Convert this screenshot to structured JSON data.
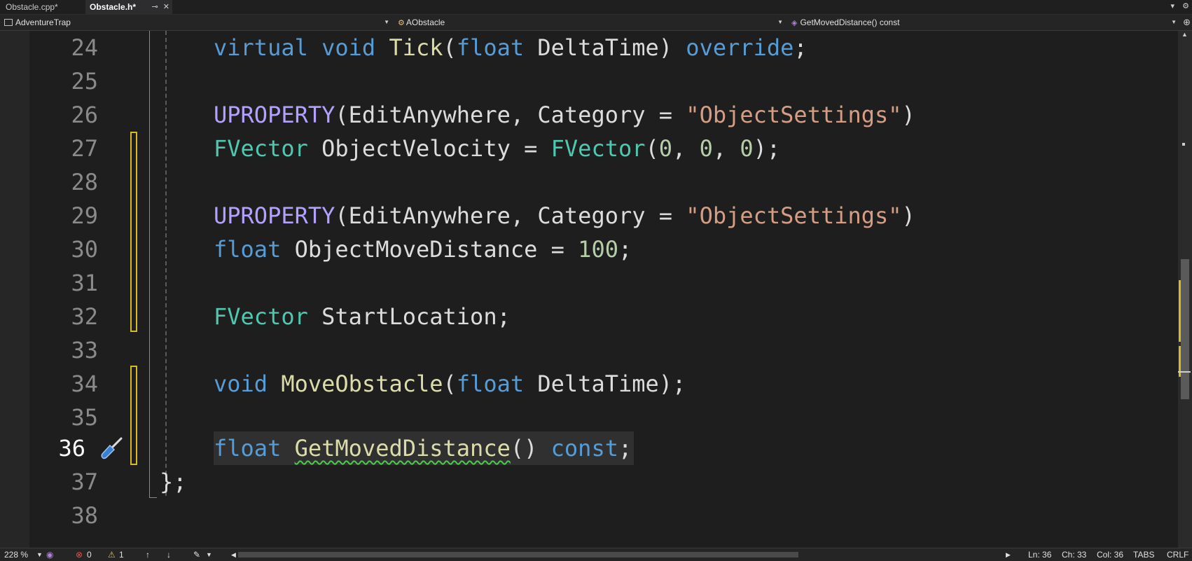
{
  "tabs": [
    {
      "label": "Obstacle.cpp*",
      "active": false
    },
    {
      "label": "Obstacle.h*",
      "active": true
    }
  ],
  "tab_icons": {
    "pin": "⊸",
    "close": "✕"
  },
  "tabbar_right": {
    "dropdown": "▾",
    "settings": "⚙"
  },
  "navbar": {
    "project": "AdventureTrap",
    "class": "AObstacle",
    "member": "GetMovedDistance() const"
  },
  "editor": {
    "current_line": 36,
    "lines": [
      {
        "num": "24",
        "text": "virtual void Tick(float DeltaTime) override;"
      },
      {
        "num": "25",
        "text": ""
      },
      {
        "num": "26",
        "text": "UPROPERTY(EditAnywhere, Category = \"ObjectSettings\")"
      },
      {
        "num": "27",
        "text": "FVector ObjectVelocity = FVector(0, 0, 0);"
      },
      {
        "num": "28",
        "text": ""
      },
      {
        "num": "29",
        "text": "UPROPERTY(EditAnywhere, Category = \"ObjectSettings\")"
      },
      {
        "num": "30",
        "text": "float ObjectMoveDistance = 100;"
      },
      {
        "num": "31",
        "text": ""
      },
      {
        "num": "32",
        "text": "FVector StartLocation;"
      },
      {
        "num": "33",
        "text": ""
      },
      {
        "num": "34",
        "text": "void MoveObstacle(float DeltaTime);"
      },
      {
        "num": "35",
        "text": ""
      },
      {
        "num": "36",
        "text": "float GetMovedDistance() const;"
      },
      {
        "num": "37",
        "text": "};"
      },
      {
        "num": "38",
        "text": ""
      }
    ]
  },
  "colors": {
    "keyword": "#569cd6",
    "type": "#4ec9b0",
    "macro": "#b4a0ff",
    "string": "#d69d85",
    "number": "#b5cea8",
    "function": "#dcdcaa",
    "change_marker": "#d7ba2a"
  },
  "statusbar": {
    "zoom": "228 %",
    "errors": "0",
    "warnings": "1",
    "ln": "Ln: 36",
    "ch": "Ch: 33",
    "col": "Col: 36",
    "indent": "TABS",
    "eol": "CRLF"
  }
}
